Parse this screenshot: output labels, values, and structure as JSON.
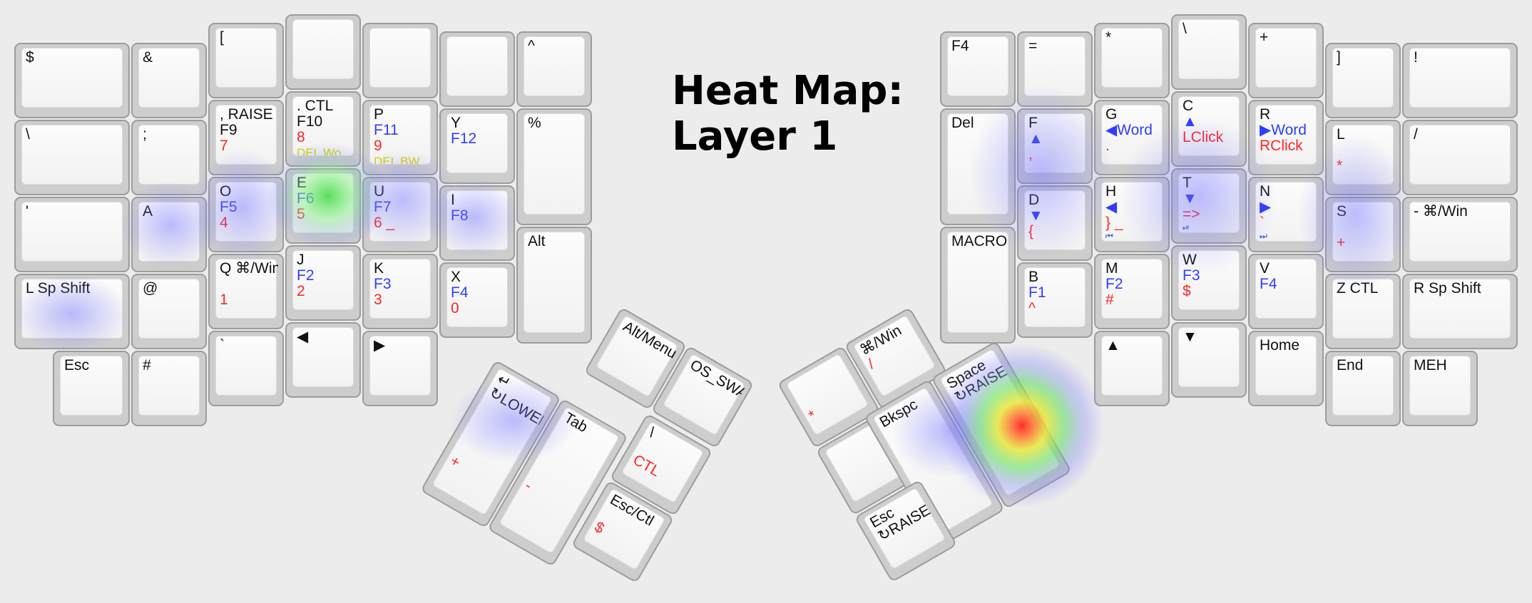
{
  "title": {
    "line1": "Heat Map:",
    "line2": "Layer 1"
  },
  "colors": {
    "background": "#ececec",
    "key_border": "#9c9c9c",
    "key_face": "#f9f9f9",
    "primary_legend": "#111111",
    "secondary_legend": "#2f3dff",
    "tertiary_legend": "#ff2626",
    "edit_legend": "#d8d000"
  },
  "keys": [
    {
      "id": "k-dollar",
      "labels": [
        {
          "t": "$"
        }
      ]
    },
    {
      "id": "k-amp",
      "labels": [
        {
          "t": "&"
        }
      ]
    },
    {
      "id": "k-lbracket",
      "labels": [
        {
          "t": "["
        }
      ]
    },
    {
      "id": "k-blank-top-1",
      "labels": []
    },
    {
      "id": "k-blank-top-2",
      "labels": []
    },
    {
      "id": "k-blank-top-3",
      "labels": []
    },
    {
      "id": "k-caret",
      "labels": [
        {
          "t": "^"
        }
      ]
    },
    {
      "id": "k-backslash",
      "labels": [
        {
          "t": "\\"
        }
      ]
    },
    {
      "id": "k-semicolon",
      "labels": [
        {
          "t": ";"
        }
      ]
    },
    {
      "id": "k-raise-f9",
      "labels": [
        {
          "t": ", RAISE"
        },
        {
          "t": "F9"
        },
        {
          "t": "7",
          "c": "red"
        }
      ]
    },
    {
      "id": "k-dot-ctl",
      "labels": [
        {
          "t": ". CTL"
        },
        {
          "t": "F10"
        },
        {
          "t": "8",
          "c": "red"
        },
        {
          "t": "DEL Wo",
          "c": "yellow"
        }
      ]
    },
    {
      "id": "k-p",
      "labels": [
        {
          "t": "P"
        },
        {
          "t": "F11",
          "c": "blue"
        },
        {
          "t": "9",
          "c": "red"
        },
        {
          "t": "DEL BW",
          "c": "yellow"
        }
      ]
    },
    {
      "id": "k-y",
      "labels": [
        {
          "t": "Y"
        },
        {
          "t": "F12",
          "c": "blue"
        }
      ]
    },
    {
      "id": "k-percent",
      "labels": [
        {
          "t": "%"
        }
      ]
    },
    {
      "id": "k-quote",
      "labels": [
        {
          "t": "'"
        }
      ]
    },
    {
      "id": "k-a",
      "labels": [
        {
          "t": "A"
        }
      ]
    },
    {
      "id": "k-o",
      "labels": [
        {
          "t": "O"
        },
        {
          "t": "F5",
          "c": "blue"
        },
        {
          "t": "4",
          "c": "red"
        }
      ]
    },
    {
      "id": "k-e",
      "labels": [
        {
          "t": "E"
        },
        {
          "t": "F6",
          "c": "blue"
        },
        {
          "t": "5",
          "c": "red"
        }
      ]
    },
    {
      "id": "k-u",
      "labels": [
        {
          "t": "U"
        },
        {
          "t": "F7",
          "c": "blue"
        },
        {
          "t": "6 _",
          "c": "red"
        }
      ]
    },
    {
      "id": "k-i",
      "labels": [
        {
          "t": "I"
        },
        {
          "t": "F8",
          "c": "blue"
        }
      ]
    },
    {
      "id": "k-alt",
      "labels": [
        {
          "t": "Alt"
        }
      ]
    },
    {
      "id": "k-lspshift",
      "labels": [
        {
          "t": "L Sp Shift"
        }
      ]
    },
    {
      "id": "k-at",
      "labels": [
        {
          "t": "@"
        }
      ]
    },
    {
      "id": "k-q",
      "labels": [
        {
          "t": "Q ⌘/Win"
        },
        {
          "t": ""
        },
        {
          "t": "1",
          "c": "red"
        }
      ]
    },
    {
      "id": "k-j",
      "labels": [
        {
          "t": "J"
        },
        {
          "t": "F2",
          "c": "blue"
        },
        {
          "t": "2",
          "c": "red"
        }
      ]
    },
    {
      "id": "k-k",
      "labels": [
        {
          "t": "K"
        },
        {
          "t": "F3",
          "c": "blue"
        },
        {
          "t": "3",
          "c": "red"
        }
      ]
    },
    {
      "id": "k-x",
      "labels": [
        {
          "t": "X"
        },
        {
          "t": "F4",
          "c": "blue"
        },
        {
          "t": "0",
          "c": "red"
        }
      ]
    },
    {
      "id": "k-esc",
      "labels": [
        {
          "t": "Esc"
        }
      ]
    },
    {
      "id": "k-hash",
      "labels": [
        {
          "t": "#"
        }
      ]
    },
    {
      "id": "k-backtick",
      "labels": [
        {
          "t": "`"
        }
      ]
    },
    {
      "id": "k-left",
      "labels": [
        {
          "t": "◀"
        }
      ]
    },
    {
      "id": "k-right",
      "labels": [
        {
          "t": "▶"
        }
      ]
    },
    {
      "id": "k-f4",
      "labels": [
        {
          "t": "F4"
        }
      ]
    },
    {
      "id": "k-equals",
      "labels": [
        {
          "t": "="
        }
      ]
    },
    {
      "id": "k-asterisk",
      "labels": [
        {
          "t": "*"
        }
      ]
    },
    {
      "id": "k-bslash-r",
      "labels": [
        {
          "t": "\\"
        }
      ]
    },
    {
      "id": "k-plus",
      "labels": [
        {
          "t": "+"
        }
      ]
    },
    {
      "id": "k-rbracket",
      "labels": [
        {
          "t": "]"
        }
      ]
    },
    {
      "id": "k-excl",
      "labels": [
        {
          "t": "!"
        }
      ]
    },
    {
      "id": "k-del",
      "labels": [
        {
          "t": "Del"
        }
      ]
    },
    {
      "id": "k-f",
      "labels": [
        {
          "t": "F"
        },
        {
          "t": "▲",
          "c": "blue"
        },
        {
          "t": ",",
          "c": "red"
        }
      ]
    },
    {
      "id": "k-g",
      "labels": [
        {
          "t": "G"
        },
        {
          "t": "◀Word",
          "c": "blue"
        },
        {
          "t": ".",
          "c": "red"
        }
      ]
    },
    {
      "id": "k-c",
      "labels": [
        {
          "t": "C"
        },
        {
          "t": "▲",
          "c": "blue"
        },
        {
          "t": "LClick",
          "c": "red"
        }
      ]
    },
    {
      "id": "k-r",
      "labels": [
        {
          "t": "R"
        },
        {
          "t": "▶Word",
          "c": "blue"
        },
        {
          "t": "RClick",
          "c": "red"
        }
      ]
    },
    {
      "id": "k-l",
      "labels": [
        {
          "t": "L"
        },
        {
          "t": ""
        },
        {
          "t": "*",
          "c": "red"
        }
      ]
    },
    {
      "id": "k-slash",
      "labels": [
        {
          "t": "/"
        }
      ]
    },
    {
      "id": "k-macro",
      "labels": [
        {
          "t": "MACRO"
        }
      ]
    },
    {
      "id": "k-d",
      "labels": [
        {
          "t": "D"
        },
        {
          "t": "▼",
          "c": "blue"
        },
        {
          "t": "{",
          "c": "red"
        }
      ]
    },
    {
      "id": "k-h",
      "labels": [
        {
          "t": "H"
        },
        {
          "t": "◀",
          "c": "blue"
        },
        {
          "t": "} _",
          "c": "red"
        },
        {
          "t": "⏮",
          "c": "tiny"
        }
      ]
    },
    {
      "id": "k-t",
      "labels": [
        {
          "t": "T"
        },
        {
          "t": "▼",
          "c": "blue"
        },
        {
          "t": "=>",
          "c": "red"
        },
        {
          "t": "⏯",
          "c": "tiny"
        }
      ]
    },
    {
      "id": "k-n",
      "labels": [
        {
          "t": "N"
        },
        {
          "t": "▶",
          "c": "blue"
        },
        {
          "t": "`",
          "c": "red"
        },
        {
          "t": "⏭",
          "c": "tiny"
        }
      ]
    },
    {
      "id": "k-s",
      "labels": [
        {
          "t": "S"
        },
        {
          "t": ""
        },
        {
          "t": "+",
          "c": "red"
        }
      ]
    },
    {
      "id": "k-minus-win",
      "labels": [
        {
          "t": "- ⌘/Win"
        }
      ]
    },
    {
      "id": "k-b",
      "labels": [
        {
          "t": "B"
        },
        {
          "t": "F1",
          "c": "blue"
        },
        {
          "t": "^",
          "c": "red"
        }
      ]
    },
    {
      "id": "k-m",
      "labels": [
        {
          "t": "M"
        },
        {
          "t": "F2",
          "c": "blue"
        },
        {
          "t": "#",
          "c": "red"
        }
      ]
    },
    {
      "id": "k-w",
      "labels": [
        {
          "t": "W"
        },
        {
          "t": "F3",
          "c": "blue"
        },
        {
          "t": "$",
          "c": "red"
        }
      ]
    },
    {
      "id": "k-v",
      "labels": [
        {
          "t": "V"
        },
        {
          "t": "F4",
          "c": "blue"
        }
      ]
    },
    {
      "id": "k-zctl",
      "labels": [
        {
          "t": "Z CTL"
        }
      ]
    },
    {
      "id": "k-rspshift",
      "labels": [
        {
          "t": "R Sp Shift"
        }
      ]
    },
    {
      "id": "k-up",
      "labels": [
        {
          "t": "▲"
        }
      ]
    },
    {
      "id": "k-down",
      "labels": [
        {
          "t": "▼"
        }
      ]
    },
    {
      "id": "k-home",
      "labels": [
        {
          "t": "Home"
        }
      ]
    },
    {
      "id": "k-end",
      "labels": [
        {
          "t": "End"
        }
      ]
    },
    {
      "id": "k-meh",
      "labels": [
        {
          "t": "MEH"
        }
      ]
    },
    {
      "id": "k-altmenu",
      "labels": [
        {
          "t": "Alt/Menu"
        }
      ]
    },
    {
      "id": "k-osswap",
      "labels": [
        {
          "t": "OS_SWAP"
        }
      ]
    },
    {
      "id": "k-lower",
      "labels": [
        {
          "t": "↵"
        },
        {
          "t": "↻LOWER"
        },
        {
          "t": ""
        },
        {
          "t": ""
        },
        {
          "t": ""
        },
        {
          "t": ""
        },
        {
          "t": "+",
          "c": "red"
        }
      ]
    },
    {
      "id": "k-tab",
      "labels": [
        {
          "t": "Tab"
        },
        {
          "t": ""
        },
        {
          "t": ""
        },
        {
          "t": ""
        },
        {
          "t": ""
        },
        {
          "t": "-",
          "c": "red"
        }
      ]
    },
    {
      "id": "k-pipe-ctl",
      "labels": [
        {
          "t": "\\"
        },
        {
          "t": ""
        },
        {
          "t": "CTL",
          "c": "red"
        }
      ]
    },
    {
      "id": "k-escctl",
      "labels": [
        {
          "t": "Esc/Ctl"
        },
        {
          "t": ""
        },
        {
          "t": "$",
          "c": "red"
        }
      ]
    },
    {
      "id": "k-cmdwin",
      "labels": [
        {
          "t": "⌘/Win"
        },
        {
          "t": "/",
          "c": "red"
        }
      ]
    },
    {
      "id": "k-star-blank",
      "labels": [
        {
          "t": ""
        },
        {
          "t": ""
        },
        {
          "t": "*",
          "c": "red"
        }
      ]
    },
    {
      "id": "k-blank-thumb",
      "labels": []
    },
    {
      "id": "k-bkspc",
      "labels": [
        {
          "t": "Bkspc"
        }
      ]
    },
    {
      "id": "k-space-raise",
      "labels": [
        {
          "t": "Space"
        },
        {
          "t": "↻RAISE"
        }
      ]
    },
    {
      "id": "k-esc-raise",
      "labels": [
        {
          "t": "Esc"
        },
        {
          "t": "↻RAISE"
        }
      ]
    }
  ]
}
